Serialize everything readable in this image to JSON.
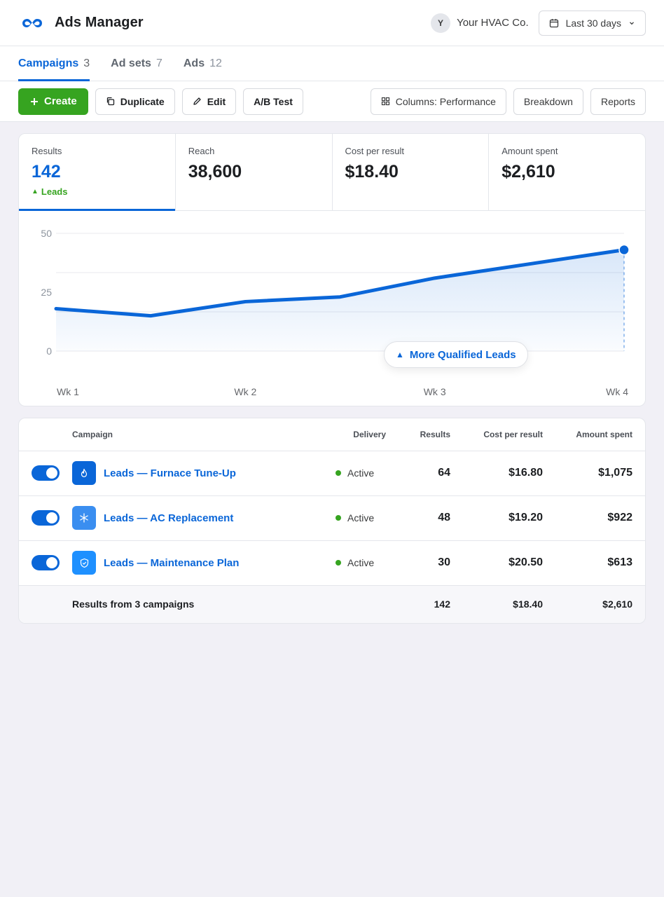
{
  "header": {
    "app_title": "Ads Manager",
    "account_initial": "Y",
    "account_name": "Your HVAC Co.",
    "date_range": "Last 30 days"
  },
  "tabs": [
    {
      "label": "Campaigns",
      "count": "3",
      "active": true
    },
    {
      "label": "Ad sets",
      "count": "7"
    },
    {
      "label": "Ads",
      "count": "12"
    }
  ],
  "toolbar": {
    "create": "Create",
    "duplicate": "Duplicate",
    "edit": "Edit",
    "ab_test": "A/B Test",
    "columns": "Columns: Performance",
    "breakdown": "Breakdown",
    "reports": "Reports"
  },
  "metrics": [
    {
      "label": "Results",
      "value": "142",
      "sub": "Leads"
    },
    {
      "label": "Reach",
      "value": "38,600"
    },
    {
      "label": "Cost per result",
      "value": "$18.40"
    },
    {
      "label": "Amount spent",
      "value": "$2,610"
    }
  ],
  "chart_data": {
    "type": "area",
    "x": [
      "Wk 1",
      "",
      "Wk 2",
      "",
      "Wk 3",
      "",
      "Wk 4"
    ],
    "x_ticks": [
      "Wk 1",
      "Wk 2",
      "Wk 3",
      "Wk 4"
    ],
    "values": [
      18,
      15,
      21,
      23,
      31,
      37,
      43
    ],
    "ylim": [
      0,
      50
    ],
    "yticks": [
      0,
      25,
      50
    ],
    "grid": true,
    "annotation": "More Qualified Leads",
    "colors": {
      "line": "#0a66d8"
    }
  },
  "table": {
    "columns": {
      "campaign": "Campaign",
      "delivery": "Delivery",
      "results": "Results",
      "cost": "Cost per result",
      "spent": "Amount spent"
    },
    "rows": [
      {
        "name": "Leads — Furnace Tune-Up",
        "delivery": "Active",
        "results": "64",
        "cost": "$16.80",
        "spent": "$1,075",
        "icon": "flame-icon",
        "color": "#0a66d8"
      },
      {
        "name": "Leads — AC Replacement",
        "delivery": "Active",
        "results": "48",
        "cost": "$19.20",
        "spent": "$922",
        "icon": "snowflake-icon",
        "color": "#3a8ef0"
      },
      {
        "name": "Leads — Maintenance Plan",
        "delivery": "Active",
        "results": "30",
        "cost": "$20.50",
        "spent": "$613",
        "icon": "shield-icon",
        "color": "#1e90ff"
      }
    ],
    "total": {
      "label": "Results from 3 campaigns",
      "results": "142",
      "cost": "$18.40",
      "spent": "$2,610"
    }
  }
}
